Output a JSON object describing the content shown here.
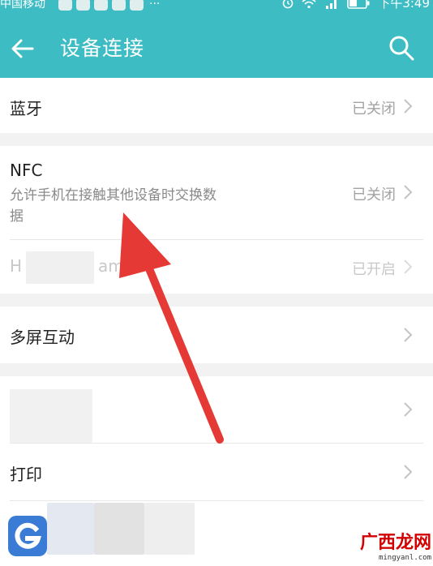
{
  "status_bar": {
    "carrier": "中国移动",
    "time": "下午3:49"
  },
  "header": {
    "title": "设备连接"
  },
  "rows": {
    "bluetooth": {
      "label": "蓝牙",
      "value": "已关闭"
    },
    "nfc": {
      "label": "NFC",
      "desc_line1": "允许手机在接触其他设备时交换数",
      "desc_line2": "据",
      "value": "已关闭"
    },
    "huawei_share": {
      "label_start": "H",
      "label_end": "am",
      "value": "已开启"
    },
    "multiscreen": {
      "label": "多屏互动"
    },
    "print": {
      "label": "打印"
    }
  },
  "watermark": {
    "text": "广西龙网",
    "url": "mingyanl.com"
  },
  "colors": {
    "header": "#3dbcc4",
    "arrow": "#e53935"
  }
}
